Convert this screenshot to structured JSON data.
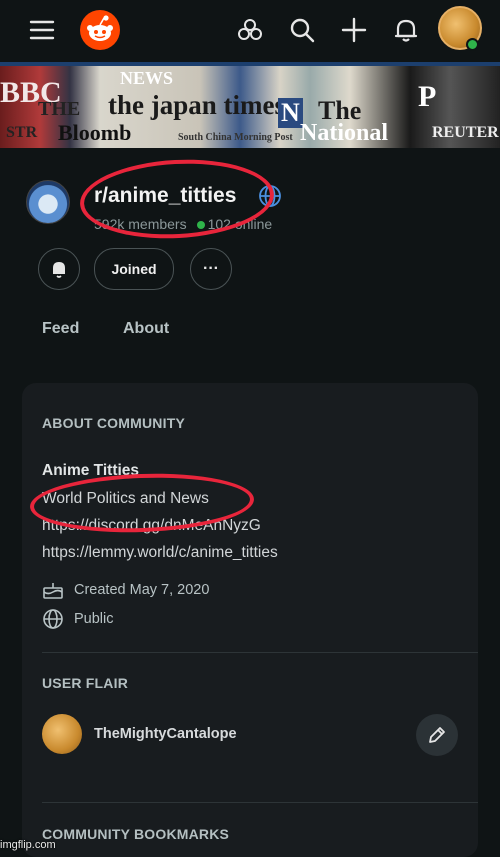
{
  "icons": {
    "menu": "menu-icon",
    "logo": "reddit-logo",
    "chat": "chat-icon",
    "search": "search-icon",
    "create": "plus-icon",
    "notifications": "bell-icon",
    "globe": "globe-icon",
    "cake": "cake-icon",
    "edit": "pencil-icon"
  },
  "banner": {
    "words": [
      "BBC",
      "THE",
      "STR",
      "Bloomb",
      "the japan times",
      "N",
      "The",
      "National",
      "South China Morning Post",
      "NEWS",
      "P",
      "REUTER"
    ]
  },
  "subreddit": {
    "name": "r/anime_titties",
    "members": "592k members",
    "online": "102 online"
  },
  "actions": {
    "joined_label": "Joined",
    "more_label": "···"
  },
  "tabs": {
    "feed": "Feed",
    "about": "About"
  },
  "about": {
    "heading": "ABOUT COMMUNITY",
    "title": "Anime Titties",
    "description": "World Politics and News",
    "link1": "https://discord.gg/dnMeAnNyzG",
    "link2": "https://lemmy.world/c/anime_titties",
    "created": "Created May 7, 2020",
    "visibility": "Public"
  },
  "flair": {
    "heading": "USER FLAIR",
    "username": "TheMightyCantalope"
  },
  "bookmarks": {
    "heading": "COMMUNITY BOOKMARKS"
  },
  "watermark": "imgflip.com",
  "colors": {
    "background": "#0f1415",
    "card": "#181c1f",
    "brand": "#ff4500",
    "online": "#2fb34a",
    "annotation": "#e8253b"
  }
}
